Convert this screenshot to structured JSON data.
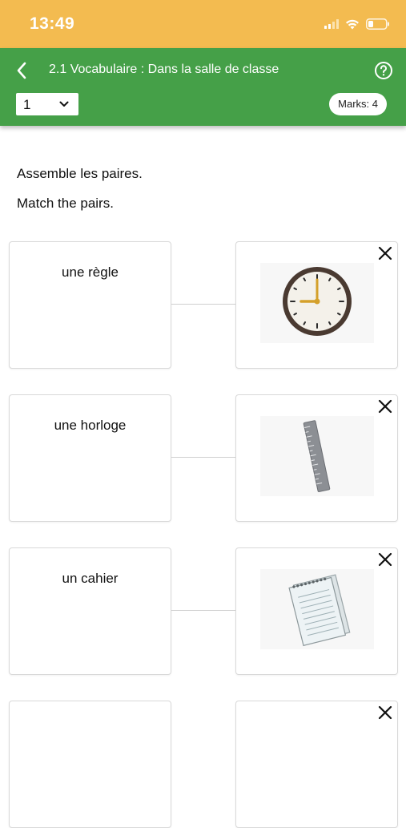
{
  "status_bar": {
    "time": "13:49",
    "background": "#f3bb50"
  },
  "header": {
    "title": "2.1 Vocabulaire : Dans la salle de classe",
    "back_icon": "chevron-left-icon",
    "help_icon": "help-circle-icon",
    "question_selector": {
      "value": "1"
    },
    "marks_badge": "Marks: 4",
    "background": "#45a048"
  },
  "instructions": {
    "french": "Assemble les paires.",
    "english": "Match the pairs."
  },
  "pairs": [
    {
      "word": "une règle",
      "image": "clock-image"
    },
    {
      "word": "une horloge",
      "image": "ruler-image"
    },
    {
      "word": "un cahier",
      "image": "notebook-image"
    },
    {
      "word": "",
      "image": ""
    }
  ]
}
